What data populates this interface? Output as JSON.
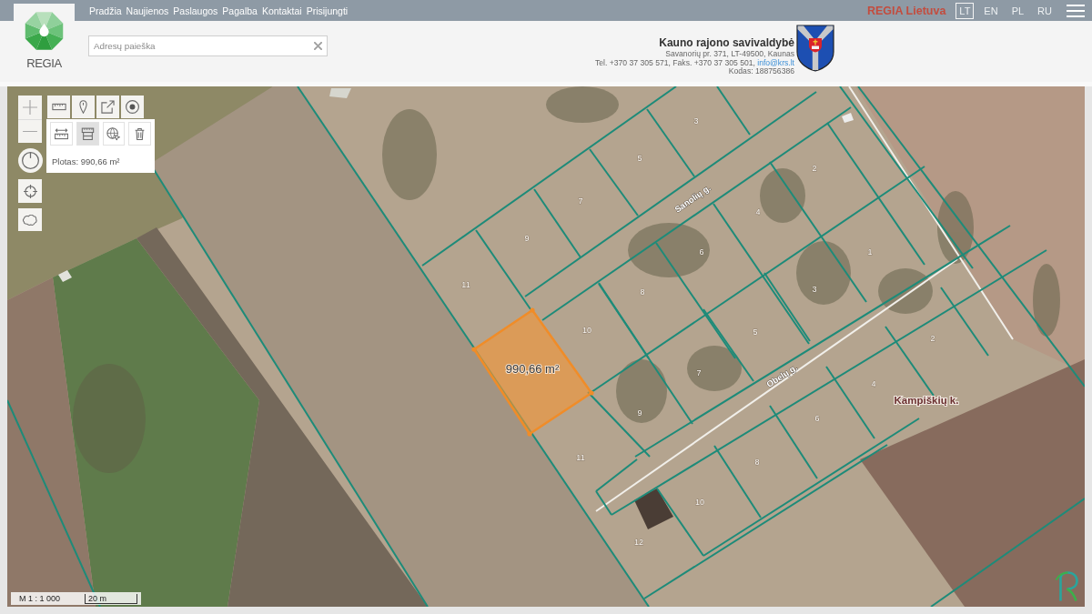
{
  "top_bar": {
    "nav": [
      "Pradžia",
      "Naujienos",
      "Paslaugos",
      "Pagalba",
      "Kontaktai",
      "Prisijungti"
    ],
    "brand": "REGIA Lietuva",
    "languages": [
      {
        "code": "LT",
        "selected": true
      },
      {
        "code": "EN",
        "selected": false
      },
      {
        "code": "PL",
        "selected": false
      },
      {
        "code": "RU",
        "selected": false
      }
    ]
  },
  "header": {
    "logo_text": "REGIA",
    "search": {
      "placeholder": "Adresų paieška"
    },
    "municipality": {
      "name": "Kauno rajono savivaldybė",
      "address": "Savanorių pr. 371, LT-49500, Kaunas",
      "phones": "Tel. +370 37 305 571, Faks. +370 37 305 501,",
      "email": "info@krs.lt",
      "code": "Kodas: 188756386"
    }
  },
  "map": {
    "measure_panel": {
      "tools": [
        {
          "selected": false
        },
        {
          "selected": true
        },
        {
          "selected": false
        },
        {
          "selected": false
        }
      ],
      "result": "Plotas: 990,66 m²"
    },
    "measured_area": {
      "label": "990,66 m²"
    },
    "parcel_numbers": [
      "3",
      "5",
      "7",
      "9",
      "11",
      "2",
      "4",
      "6",
      "1",
      "8",
      "3",
      "10",
      "5",
      "2",
      "7",
      "4",
      "9",
      "6",
      "11",
      "8",
      "10",
      "12"
    ],
    "streets": [
      "Sanolių g.",
      "Obelų g."
    ],
    "place": "Kampiškių k.",
    "scale": {
      "ratio": "M 1 : 1 000",
      "bar": "20 m"
    }
  }
}
